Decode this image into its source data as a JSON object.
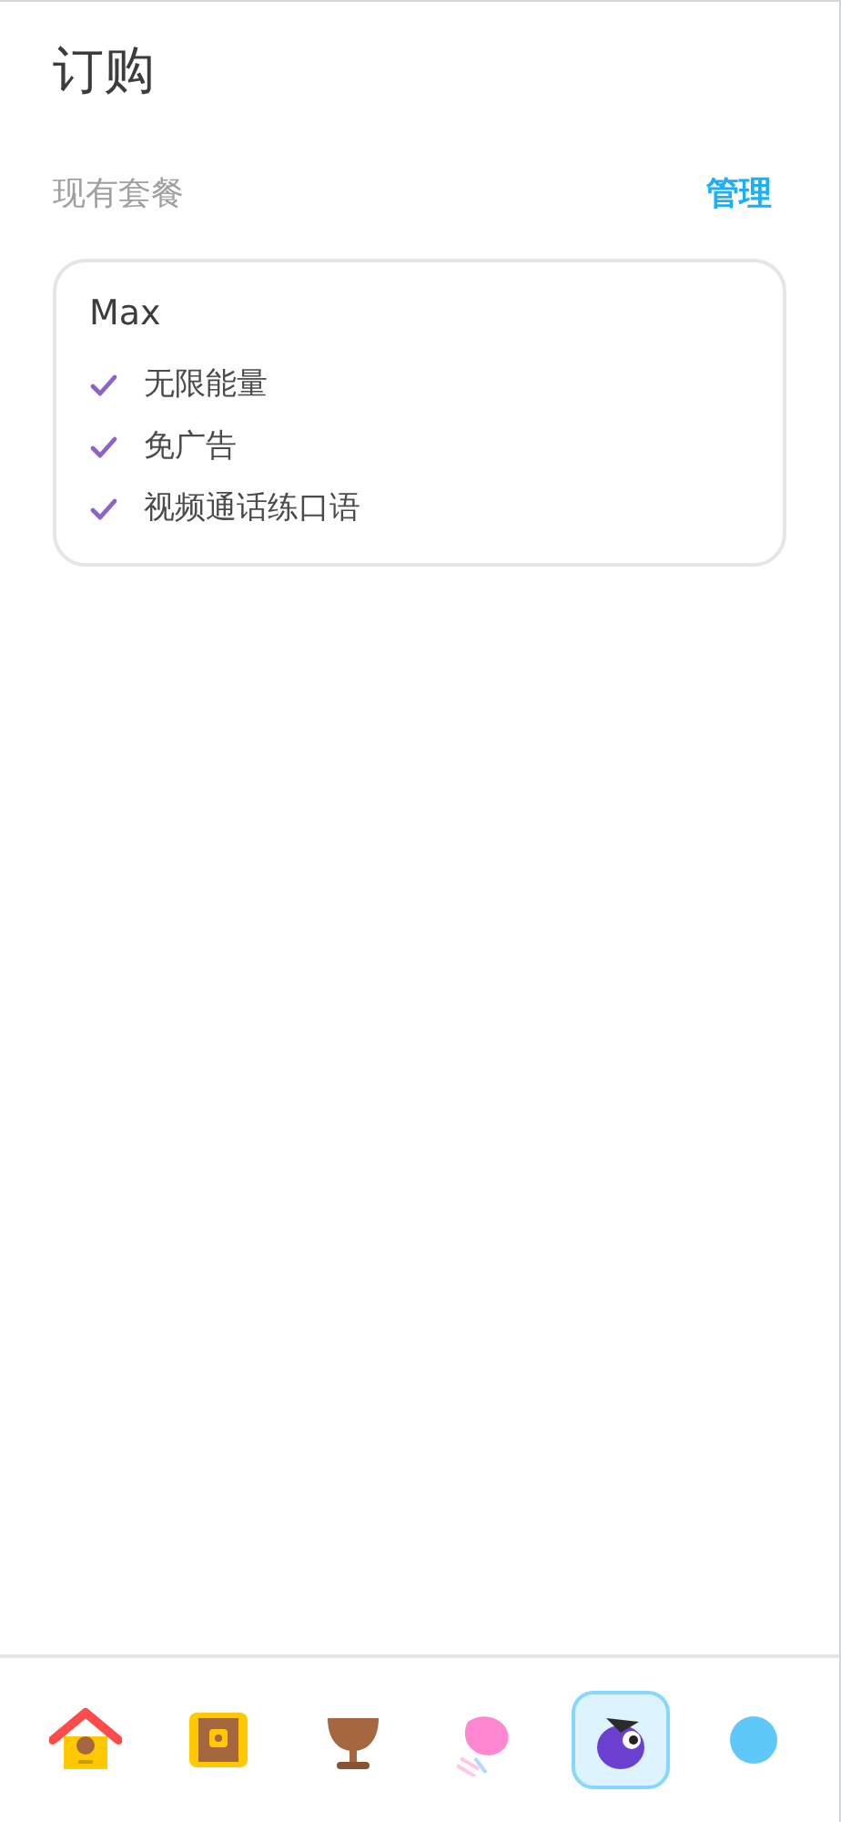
{
  "title": "订购",
  "section": {
    "label": "现有套餐",
    "action": "管理"
  },
  "plan": {
    "name": "Max",
    "features": [
      "无限能量",
      "免广告",
      "视频通话练口语"
    ]
  },
  "nav": [
    {
      "kind": "home",
      "selected": false
    },
    {
      "kind": "chest",
      "selected": false
    },
    {
      "kind": "trophy",
      "selected": false
    },
    {
      "kind": "ribbon",
      "selected": false
    },
    {
      "kind": "mascot",
      "selected": true
    },
    {
      "kind": "more",
      "selected": false
    }
  ]
}
